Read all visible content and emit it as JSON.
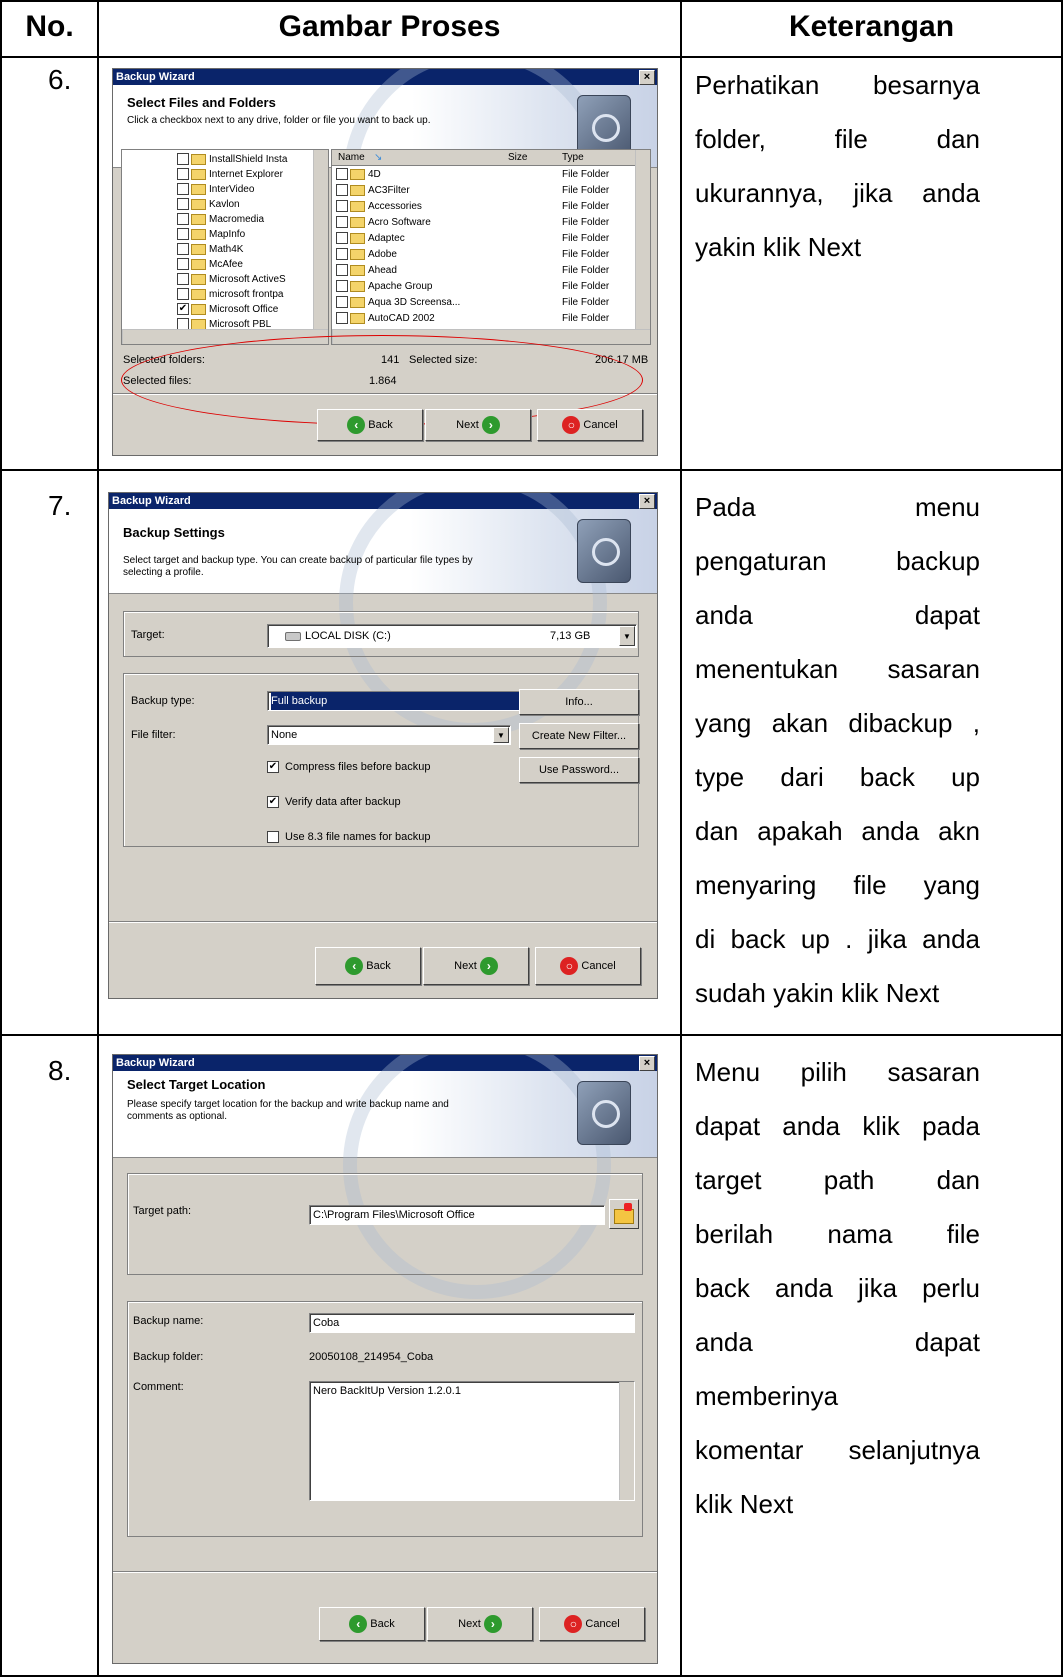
{
  "table": {
    "headers": [
      "No.",
      "Gambar Proses",
      "Keterangan"
    ]
  },
  "rows": [
    {
      "no": "6.",
      "desc_lines": [
        "Perhatikan besarnya",
        "folder, file dan",
        "ukurannya, jika anda",
        "yakin klik Next"
      ]
    },
    {
      "no": "7.",
      "desc_lines": [
        "Pada menu",
        "pengaturan backup",
        "anda dapat",
        "menentukan sasaran",
        "yang akan dibackup ,",
        "type dari back up",
        "dan apakah anda akn",
        "menyaring file yang",
        "di back up . jika anda",
        "sudah yakin klik Next"
      ]
    },
    {
      "no": "8.",
      "desc_lines": [
        "Menu pilih sasaran",
        "dapat anda klik pada",
        "target path dan",
        "berilah nama file",
        "back anda jika perlu",
        "anda dapat",
        "memberinya",
        "komentar selanjutnya",
        "klik Next"
      ]
    }
  ],
  "dialogs": {
    "common": {
      "window_title": "Backup Wizard",
      "close_glyph": "×",
      "back_label": "Back",
      "next_label": "Next",
      "cancel_label": "Cancel"
    },
    "files": {
      "title": "Select Files and Folders",
      "subtitle": "Click a checkbox next to any drive, folder or file you want to back up.",
      "tree_items": [
        "InstallShield Insta",
        "Internet Explorer",
        "InterVideo",
        "Kavlon",
        "Macromedia",
        "MapInfo",
        "Math4K",
        "McAfee",
        "Microsoft ActiveS",
        "microsoft frontpa",
        "Microsoft Office",
        "Microsoft PBL"
      ],
      "tree_checked_index": 10,
      "col_name": "Name",
      "col_size": "Size",
      "col_type": "Type",
      "list_items": [
        "4D",
        "AC3Filter",
        "Accessories",
        "Acro Software",
        "Adaptec",
        "Adobe",
        "Ahead",
        "Apache Group",
        "Aqua 3D Screensa...",
        "AutoCAD 2002"
      ],
      "list_type": "File Folder",
      "selected_folders_label": "Selected folders:",
      "selected_folders_value": "141",
      "selected_size_label": "Selected size:",
      "selected_size_value": "206.17 MB",
      "selected_files_label": "Selected files:",
      "selected_files_value": "1.864"
    },
    "settings": {
      "title": "Backup Settings",
      "subtitle": "Select target and backup type. You can create backup of particular file types by selecting a profile.",
      "target_label": "Target:",
      "target_value": "LOCAL DISK (C:)",
      "target_size": "7,13 GB",
      "backup_type_label": "Backup type:",
      "backup_type_value": "Full backup",
      "info_button": "Info...",
      "file_filter_label": "File filter:",
      "file_filter_value": "None",
      "create_filter_button": "Create New Filter...",
      "use_password_button": "Use Password...",
      "compress_label": "Compress files before backup",
      "verify_label": "Verify data after backup",
      "use83_label": "Use 8.3 file names for backup",
      "check_mark": "✔"
    },
    "target": {
      "title": "Select Target Location",
      "subtitle": "Please specify target location for the backup and write backup name and comments as optional.",
      "target_path_label": "Target path:",
      "target_path_value": "C:\\Program Files\\Microsoft Office",
      "backup_name_label": "Backup name:",
      "backup_name_value": "Coba",
      "backup_folder_label": "Backup folder:",
      "backup_folder_value": "20050108_214954_Coba",
      "comment_label": "Comment:",
      "comment_value": "Nero BackItUp Version 1.2.0.1"
    }
  }
}
